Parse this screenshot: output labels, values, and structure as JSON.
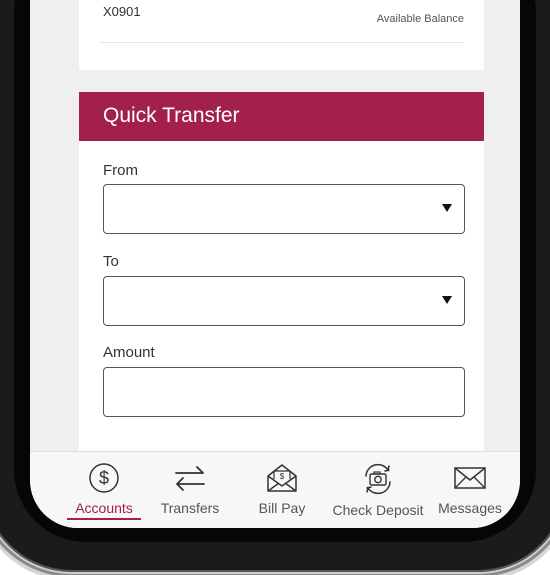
{
  "account": {
    "number": "X0901",
    "balance_label": "Available Balance"
  },
  "quick_transfer": {
    "title": "Quick Transfer",
    "from_label": "From",
    "from_value": "",
    "to_label": "To",
    "to_value": "",
    "amount_label": "Amount",
    "amount_value": ""
  },
  "bottom_nav": {
    "items": [
      {
        "label": "Accounts",
        "icon": "dollar-circle-icon",
        "active": true
      },
      {
        "label": "Transfers",
        "icon": "transfer-arrows-icon",
        "active": false
      },
      {
        "label": "Bill Pay",
        "icon": "bill-envelope-icon",
        "active": false
      },
      {
        "label": "Check Deposit",
        "icon": "camera-refresh-icon",
        "active": false
      },
      {
        "label": "Messages",
        "icon": "envelope-icon",
        "active": false
      }
    ]
  },
  "colors": {
    "accent": "#a3204e",
    "screen_bg": "#efefef"
  }
}
